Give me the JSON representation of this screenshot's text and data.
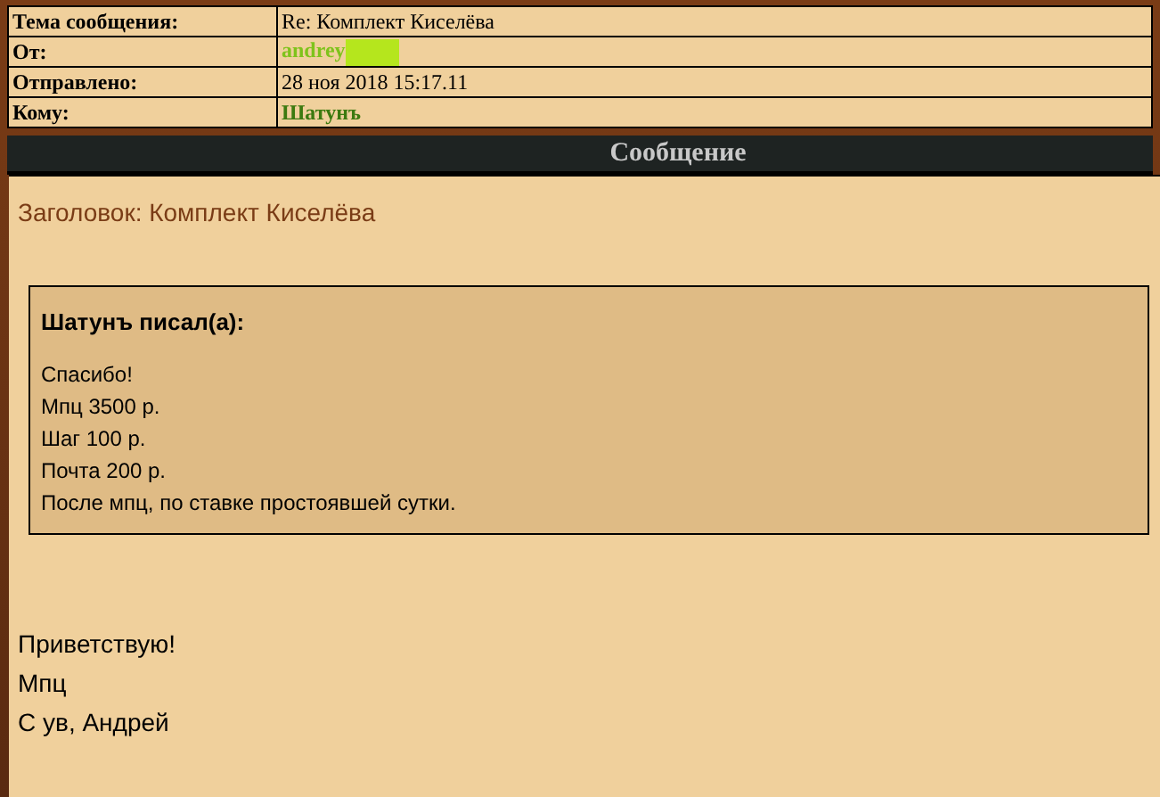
{
  "header_fields": [
    {
      "label": "Тема сообщения:",
      "value": "Re: Комплект Киселёва",
      "kind": "plain"
    },
    {
      "label": "От:",
      "value": "andrey",
      "kind": "sender"
    },
    {
      "label": "Отправлено:",
      "value": "28 ноя 2018 15:17.11",
      "kind": "plain"
    },
    {
      "label": "Кому:",
      "value": "Шатунъ",
      "kind": "recipient"
    }
  ],
  "section_title": "Сообщение",
  "subject": "Заголовок: Комплект Киселёва",
  "quote": {
    "author": "Шатунъ писал(а):",
    "lines": [
      "Спасибо!",
      "Мпц 3500 р.",
      "Шаг 100 р.",
      "Почта 200 р.",
      "После мпц, по ставке простоявшей сутки."
    ]
  },
  "body_lines": [
    "Приветствую!",
    "Мпц",
    "С ув, Андрей"
  ]
}
